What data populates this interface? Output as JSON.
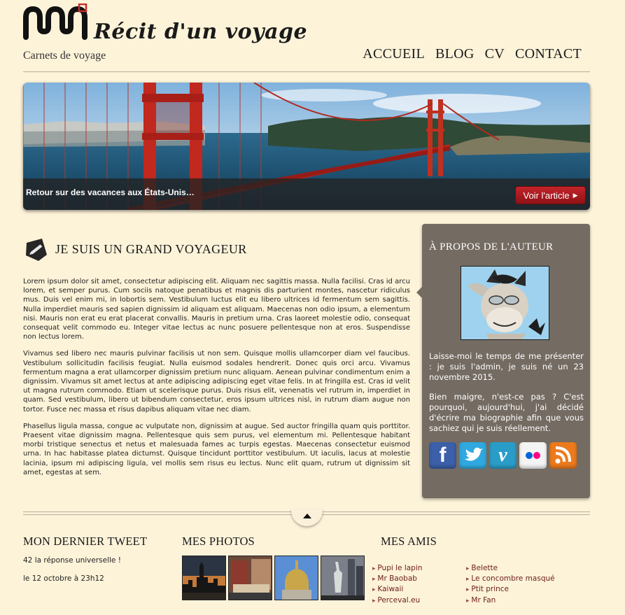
{
  "header": {
    "logo_alt": "MW logo",
    "title": "Récit d'un voyage",
    "tagline": "Carnets de voyage"
  },
  "nav": {
    "items": [
      "ACCUEIL",
      "BLOG",
      "CV",
      "CONTACT"
    ]
  },
  "banner": {
    "caption": "Retour sur des vacances aux États-Unis…",
    "button_label": "Voir l'article",
    "button_icon": "play-triangle-icon"
  },
  "article": {
    "icon": "pencil-icon",
    "title": "JE SUIS UN GRAND VOYAGEUR",
    "paragraphs": [
      "Lorem ipsum dolor sit amet, consectetur adipiscing elit. Aliquam nec sagittis massa. Nulla facilisi. Cras id arcu lorem, et semper purus. Cum sociis natoque penatibus et magnis dis parturient montes, nascetur ridiculus mus. Duis vel enim mi, in lobortis sem. Vestibulum luctus elit eu libero ultrices id fermentum sem sagittis. Nulla imperdiet mauris sed sapien dignissim id aliquam est aliquam. Maecenas non odio ipsum, a elementum nisi. Mauris non erat eu erat placerat convallis. Mauris in pretium urna. Cras laoreet molestie odio, consequat consequat velit commodo eu. Integer vitae lectus ac nunc posuere pellentesque non at eros. Suspendisse non lectus lorem.",
      "Vivamus sed libero nec mauris pulvinar facilisis ut non sem. Quisque mollis ullamcorper diam vel faucibus. Vestibulum sollicitudin facilisis feugiat. Nulla euismod sodales hendrerit. Donec quis orci arcu. Vivamus fermentum magna a erat ullamcorper dignissim pretium nunc aliquam. Aenean pulvinar condimentum enim a dignissim. Vivamus sit amet lectus at ante adipiscing adipiscing eget vitae felis. In at fringilla est. Cras id velit ut magna rutrum commodo. Etiam ut scelerisque purus. Duis risus elit, venenatis vel rutrum in, imperdiet in quam. Sed vestibulum, libero ut bibendum consectetur, eros ipsum ultrices nisl, in rutrum diam augue non tortor. Fusce nec massa et risus dapibus aliquam vitae nec diam.",
      "Phasellus ligula massa, congue ac vulputate non, dignissim at augue. Sed auctor fringilla quam quis porttitor. Praesent vitae dignissim magna. Pellentesque quis sem purus, vel elementum mi. Pellentesque habitant morbi tristique senectus et netus et malesuada fames ac turpis egestas. Maecenas consectetur euismod urna. In hac habitasse platea dictumst. Quisque tincidunt porttitor vestibulum. Ut iaculis, lacus at molestie lacinia, ipsum mi adipiscing ligula, vel mollis sem risus eu lectus. Nunc elit quam, rutrum ut dignissim sit amet, egestas at sem."
    ]
  },
  "author": {
    "title": "À PROPOS DE L'AUTEUR",
    "avatar": "donkey-avatar",
    "bio_1": "Laisse-moi le temps de me présenter : je suis l'admin, je suis né un 23 novembre 2015.",
    "bio_2": "Bien maigre, n'est-ce pas ? C'est pourquoi, aujourd'hui, j'ai décidé d'écrire ma biographie afin que vous sachiez qui je suis réellement.",
    "social": [
      {
        "name": "facebook-icon",
        "glyph": "f",
        "color": "#3b5fa8"
      },
      {
        "name": "twitter-icon",
        "glyph": "t",
        "color": "#2fa9e0"
      },
      {
        "name": "vimeo-icon",
        "glyph": "v",
        "color": "#2a9cc8"
      },
      {
        "name": "flickr-icon",
        "glyph": "••",
        "color": "#f4f4f4"
      },
      {
        "name": "rss-icon",
        "glyph": "rss",
        "color": "#ec7a1c"
      }
    ]
  },
  "footer": {
    "tweet": {
      "title": "MON DERNIER TWEET",
      "text": "42 la réponse universelle !",
      "date": "le 12 octobre à 23h12"
    },
    "photos": {
      "title": "MES PHOTOS",
      "items": [
        "skyline-photo",
        "street-photo",
        "dome-photo",
        "liberty-photo"
      ]
    },
    "friends": {
      "title": "MES AMIS",
      "col1": [
        "Pupi le lapin",
        "Mr Baobab",
        "Kaiwaii",
        "Perceval.eu"
      ],
      "col2": [
        "Belette",
        "Le concombre masqué",
        "Ptit prince",
        "Mr Fan"
      ]
    }
  },
  "colors": {
    "page_bg": "#fdf3d9",
    "author_box": "#746b62",
    "button_red": "#c3242a",
    "friend_link": "#6b1d1d"
  }
}
